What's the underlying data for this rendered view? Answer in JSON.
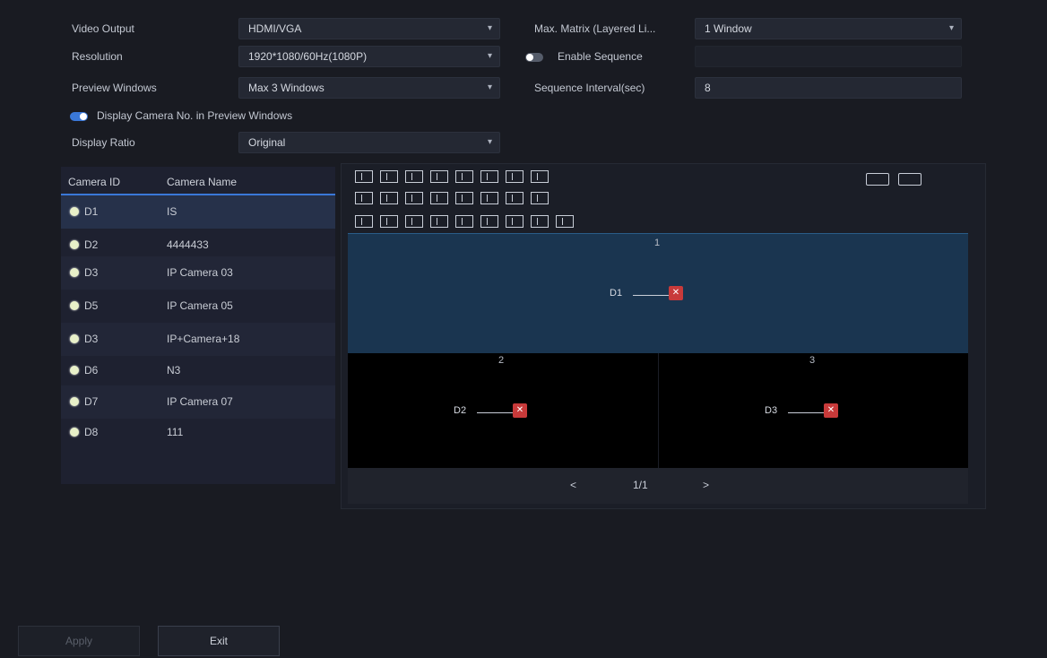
{
  "settings": {
    "video_output_label": "Video Output",
    "video_output_value": "HDMI/VGA",
    "resolution_label": "Resolution",
    "resolution_value": "1920*1080/60Hz(1080P)",
    "preview_windows_label": "Preview Windows",
    "preview_windows_value": "Max 3 Windows",
    "display_camera_no_label": "Display Camera No. in Preview Windows",
    "display_ratio_label": "Display Ratio",
    "display_ratio_value": "Original",
    "max_matrix_label": "Max. Matrix (Layered Li...",
    "max_matrix_value": "1 Window",
    "enable_sequence_label": "Enable Sequence",
    "sequence_interval_label": "Sequence Interval(sec)",
    "sequence_interval_value": "8"
  },
  "camera_list": {
    "col_id": "Camera ID",
    "col_name": "Camera Name",
    "rows": [
      {
        "id": "D1",
        "name": "IS"
      },
      {
        "id": "D2",
        "name": "4444433"
      },
      {
        "id": "D3",
        "name": "IP Camera 03"
      },
      {
        "id": "D5",
        "name": "IP Camera 05"
      },
      {
        "id": "D3",
        "name": "IP+Camera+18"
      },
      {
        "id": "D6",
        "name": "N3"
      },
      {
        "id": "D7",
        "name": "IP Camera 07"
      },
      {
        "id": "D8",
        "name": "111"
      }
    ]
  },
  "preview": {
    "win1_index": "1",
    "win1_cam": "D1",
    "win2_index": "2",
    "win2_cam": "D2",
    "win3_index": "3",
    "win3_cam": "D3",
    "close_glyph": "✕",
    "page_indicator": "1/1",
    "prev_glyph": "<",
    "next_glyph": ">"
  },
  "footer": {
    "apply_label": "Apply",
    "exit_label": "Exit"
  },
  "colors": {
    "accent": "#3a78d8",
    "selected_window": "#1a3550",
    "close_red": "#c83a3a"
  }
}
